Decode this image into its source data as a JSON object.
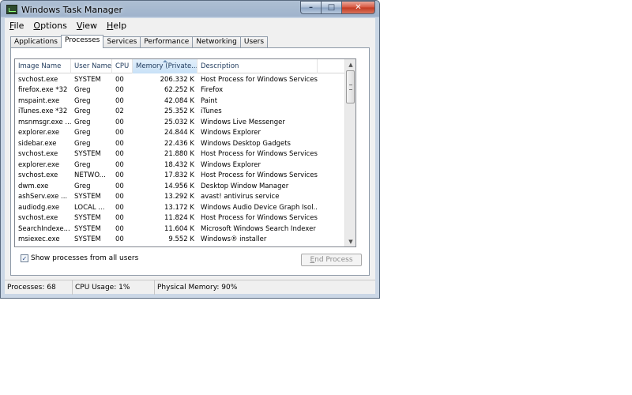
{
  "window": {
    "title": "Windows Task Manager"
  },
  "menu": [
    {
      "accel": "F",
      "rest": "ile"
    },
    {
      "accel": "O",
      "rest": "ptions"
    },
    {
      "accel": "V",
      "rest": "iew"
    },
    {
      "accel": "H",
      "rest": "elp"
    }
  ],
  "tabs": [
    "Applications",
    "Processes",
    "Services",
    "Performance",
    "Networking",
    "Users"
  ],
  "active_tab": "Processes",
  "columns": [
    "Image Name",
    "User Name",
    "CPU",
    "Memory (Private...",
    "Description"
  ],
  "rows": [
    {
      "image": "svchost.exe",
      "user": "SYSTEM",
      "cpu": "00",
      "memory": "206.332 K",
      "desc": "Host Process for Windows Services"
    },
    {
      "image": "firefox.exe *32",
      "user": "Greg",
      "cpu": "00",
      "memory": "62.252 K",
      "desc": "Firefox"
    },
    {
      "image": "mspaint.exe",
      "user": "Greg",
      "cpu": "00",
      "memory": "42.084 K",
      "desc": "Paint"
    },
    {
      "image": "iTunes.exe *32",
      "user": "Greg",
      "cpu": "02",
      "memory": "25.352 K",
      "desc": "iTunes"
    },
    {
      "image": "msnmsgr.exe ...",
      "user": "Greg",
      "cpu": "00",
      "memory": "25.032 K",
      "desc": "Windows Live Messenger"
    },
    {
      "image": "explorer.exe",
      "user": "Greg",
      "cpu": "00",
      "memory": "24.844 K",
      "desc": "Windows Explorer"
    },
    {
      "image": "sidebar.exe",
      "user": "Greg",
      "cpu": "00",
      "memory": "22.436 K",
      "desc": "Windows Desktop Gadgets"
    },
    {
      "image": "svchost.exe",
      "user": "SYSTEM",
      "cpu": "00",
      "memory": "21.880 K",
      "desc": "Host Process for Windows Services"
    },
    {
      "image": "explorer.exe",
      "user": "Greg",
      "cpu": "00",
      "memory": "18.432 K",
      "desc": "Windows Explorer"
    },
    {
      "image": "svchost.exe",
      "user": "NETWO...",
      "cpu": "00",
      "memory": "17.832 K",
      "desc": "Host Process for Windows Services"
    },
    {
      "image": "dwm.exe",
      "user": "Greg",
      "cpu": "00",
      "memory": "14.956 K",
      "desc": "Desktop Window Manager"
    },
    {
      "image": "ashServ.exe ...",
      "user": "SYSTEM",
      "cpu": "00",
      "memory": "13.292 K",
      "desc": "avast! antivirus service"
    },
    {
      "image": "audiodg.exe",
      "user": "LOCAL ...",
      "cpu": "00",
      "memory": "13.172 K",
      "desc": "Windows Audio Device Graph Isol..."
    },
    {
      "image": "svchost.exe",
      "user": "SYSTEM",
      "cpu": "00",
      "memory": "11.824 K",
      "desc": "Host Process for Windows Services"
    },
    {
      "image": "SearchIndexe...",
      "user": "SYSTEM",
      "cpu": "00",
      "memory": "11.604 K",
      "desc": "Microsoft Windows Search Indexer"
    },
    {
      "image": "msiexec.exe",
      "user": "SYSTEM",
      "cpu": "00",
      "memory": "9.552 K",
      "desc": "Windows® installer"
    }
  ],
  "show_all_label": "Show processes from all users",
  "show_all_checked": true,
  "check_mark": "✓",
  "end_process": {
    "accel": "E",
    "rest": "nd Process"
  },
  "status": {
    "processes": "Processes: 68",
    "cpu": "CPU Usage: 1%",
    "memory": "Physical Memory: 90%"
  },
  "icons": {
    "minimize": "–",
    "maximize": "□",
    "close": "✕",
    "scroll_up": "▲",
    "scroll_down": "▼"
  }
}
